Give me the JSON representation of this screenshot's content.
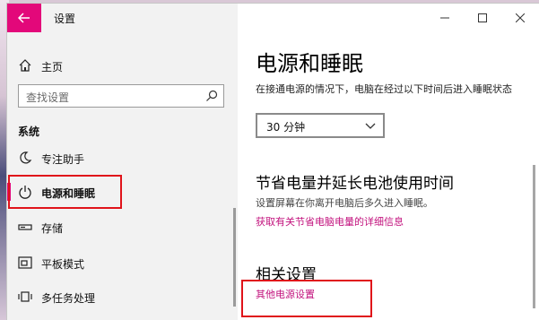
{
  "window": {
    "app_title": "设置",
    "controls": {
      "minimize": "minimize",
      "maximize": "maximize",
      "close": "close"
    }
  },
  "sidebar": {
    "home_label": "主页",
    "search_placeholder": "查找设置",
    "section_label": "系统",
    "items": [
      {
        "label": "专注助手",
        "icon": "focus-moon-icon"
      },
      {
        "label": "电源和睡眠",
        "icon": "power-icon",
        "selected": true
      },
      {
        "label": "存储",
        "icon": "storage-icon"
      },
      {
        "label": "平板模式",
        "icon": "tablet-mode-icon"
      },
      {
        "label": "多任务处理",
        "icon": "multitasking-icon"
      }
    ]
  },
  "main": {
    "title": "电源和睡眠",
    "sleep_description": "在接通电源的情况下，电脑在经过以下时间后进入睡眠状态",
    "sleep_dropdown_value": "30 分钟",
    "battery_heading": "节省电量并延长电池使用时间",
    "battery_description": "设置屏幕在你离开电脑后多久进入睡眠。",
    "battery_link": "获取有关节省电脑电量的详细信息",
    "related_heading": "相关设置",
    "related_link": "其他电源设置"
  },
  "colors": {
    "accent": "#e3087a",
    "link": "#c2127d",
    "annotation_red": "#e0131a"
  }
}
